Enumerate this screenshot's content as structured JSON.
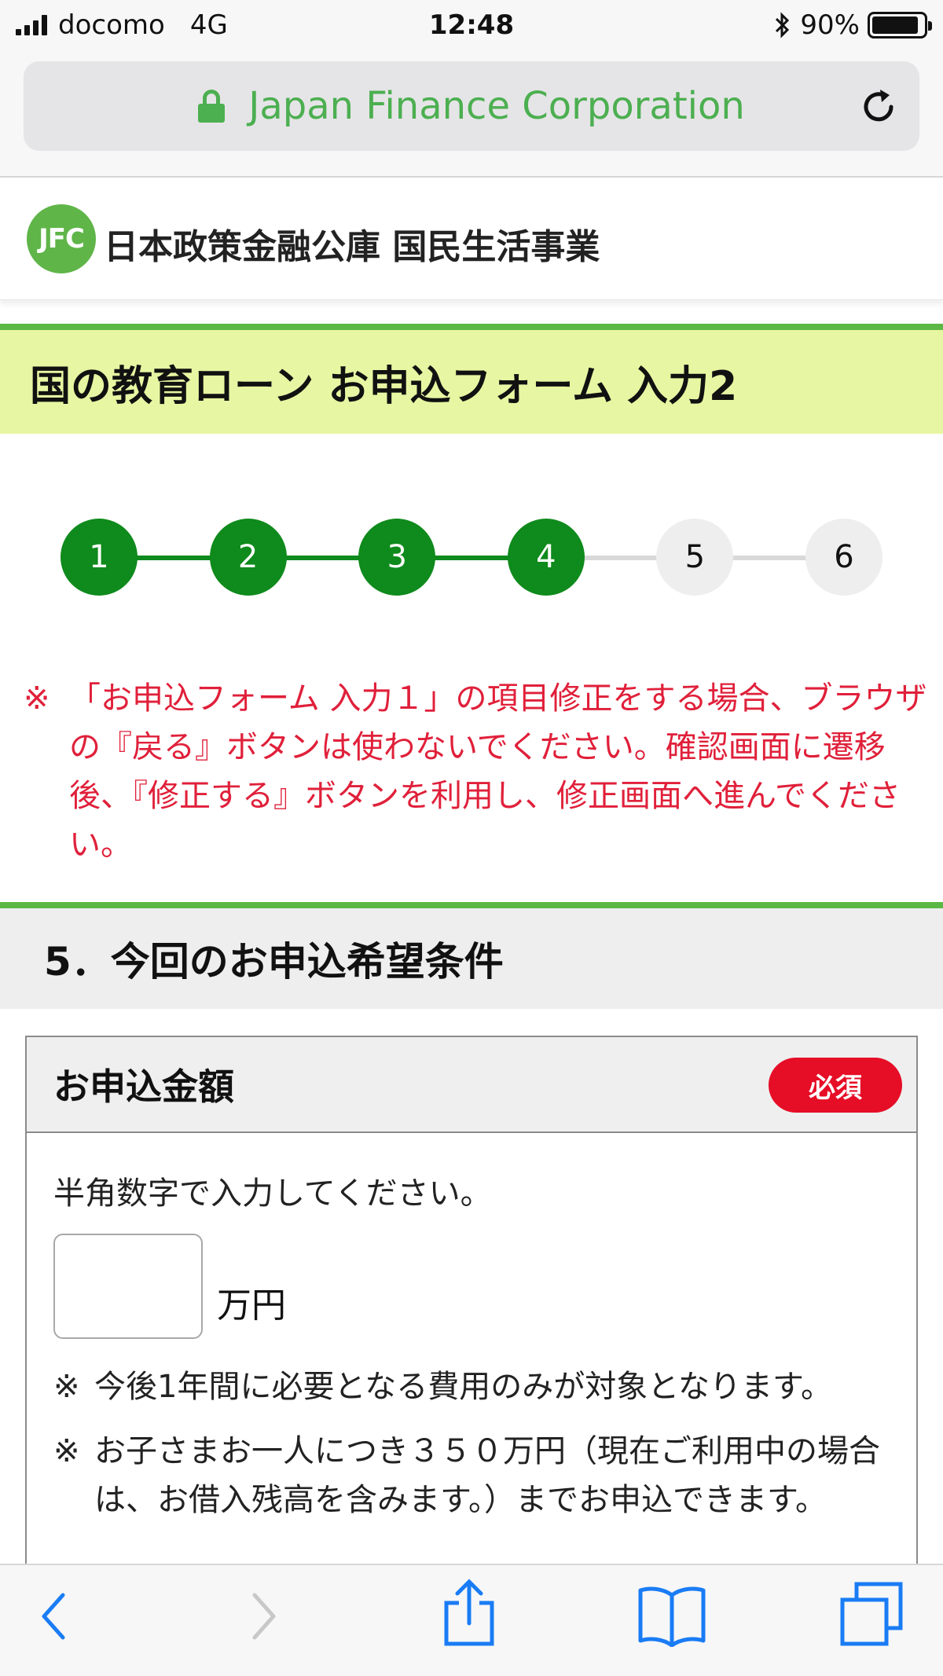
{
  "status_bar": {
    "carrier": "docomo",
    "network": "4G",
    "time": "12:48",
    "battery_percent": "90%",
    "battery_level": 0.9
  },
  "url_bar": {
    "site_label": "Japan Finance Corporation"
  },
  "site_header": {
    "logo_text": "JFC",
    "org_name": "日本政策金融公庫 国民生活事業"
  },
  "page_title": "国の教育ローン お申込フォーム 入力2",
  "stepper": {
    "steps": [
      "1",
      "2",
      "3",
      "4",
      "5",
      "6"
    ],
    "current": 4
  },
  "notice": {
    "mark": "※",
    "text": "「お申込フォーム 入力１」の項目修正をする場合、ブラウザの『戻る』ボタンは使わないでください。確認画面に遷移後、『修正する』ボタンを利用し、修正画面へ進んでください。"
  },
  "section": {
    "heading": "5．今回のお申込希望条件"
  },
  "form": {
    "field_label": "お申込金額",
    "required_badge": "必須",
    "hint": "半角数字で入力してください。",
    "input_value": "",
    "unit": "万円",
    "notes": [
      {
        "mark": "※",
        "text": "今後1年間に必要となる費用のみが対象となります。"
      },
      {
        "mark": "※",
        "text": "お子さまお一人につき３５０万円（現在ご利用中の場合は、お借入残高を含みます。）までお申込できます。"
      }
    ]
  },
  "colors": {
    "accent_green": "#5cb845",
    "step_done": "#0f8a1c",
    "title_band": "#e7f6a2",
    "warning_red": "#e0203a",
    "required_red": "#e60d26",
    "ios_blue": "#1a7cf5"
  },
  "icons": {
    "lock": "lock-icon",
    "reload": "reload-icon",
    "back": "back-arrow-icon",
    "forward": "forward-arrow-icon",
    "share": "share-icon",
    "bookmarks": "bookmarks-icon",
    "tabs": "tabs-icon"
  }
}
